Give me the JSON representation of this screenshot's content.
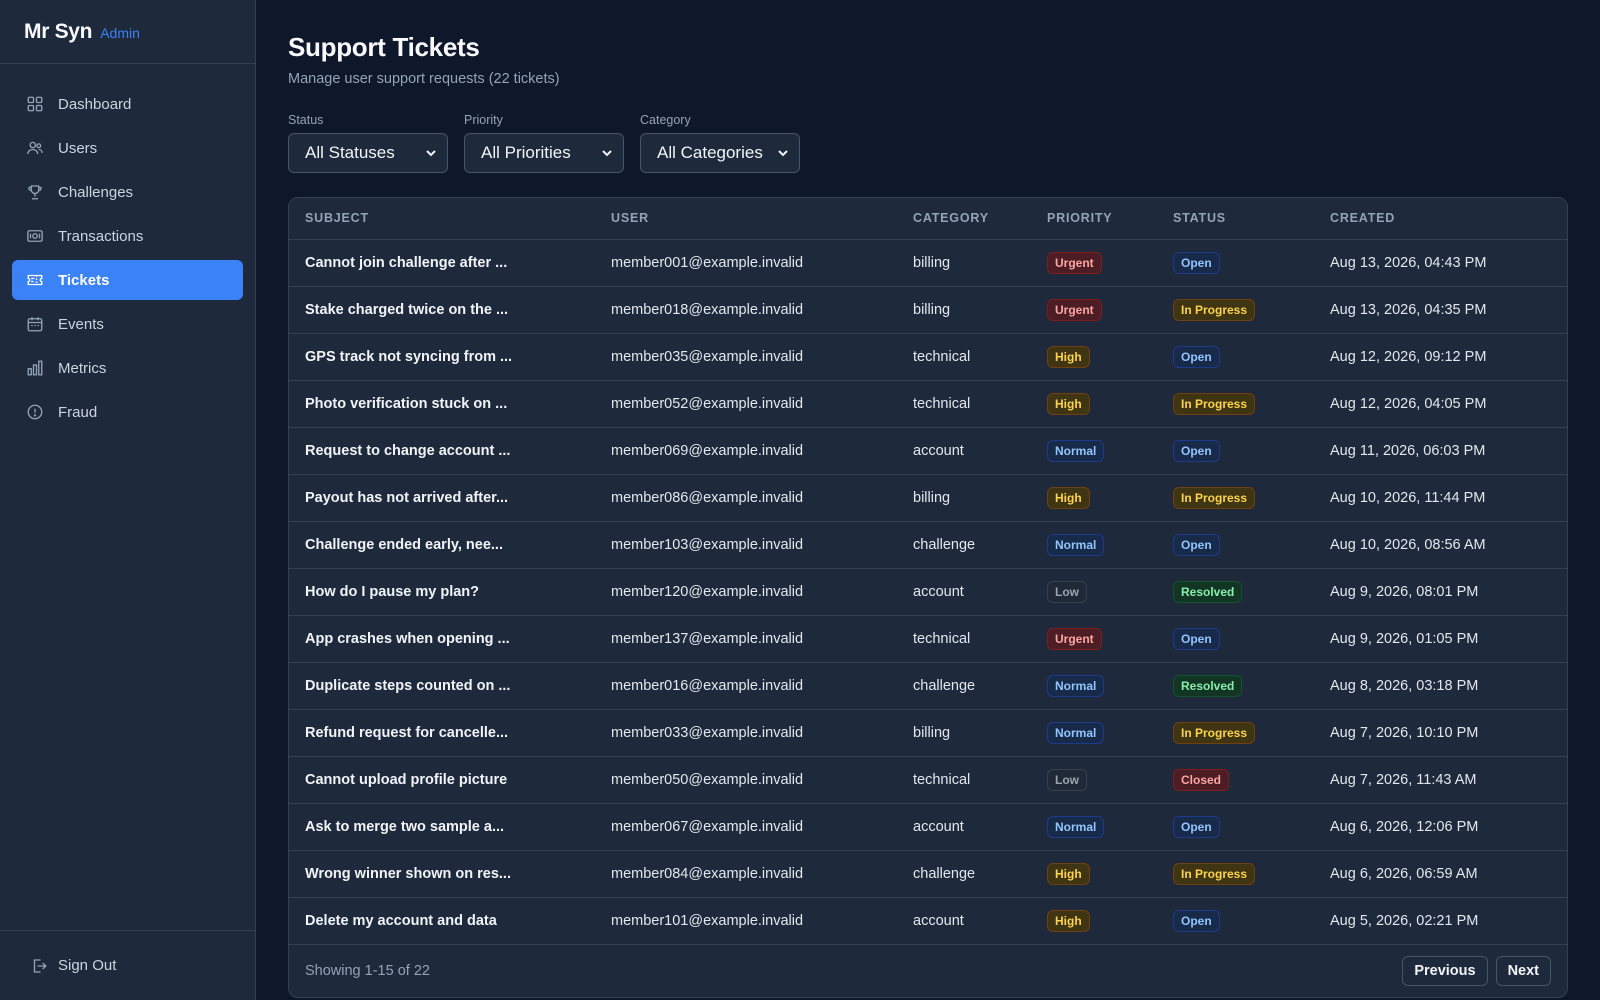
{
  "brand": {
    "name": "Mr Syn",
    "tag": "Admin"
  },
  "sidebar": {
    "items": [
      {
        "label": "Dashboard",
        "icon": "dashboard-icon"
      },
      {
        "label": "Users",
        "icon": "users-icon"
      },
      {
        "label": "Challenges",
        "icon": "trophy-icon"
      },
      {
        "label": "Transactions",
        "icon": "money-icon"
      },
      {
        "label": "Tickets",
        "icon": "ticket-icon",
        "active": true
      },
      {
        "label": "Events",
        "icon": "calendar-icon"
      },
      {
        "label": "Metrics",
        "icon": "bar-chart-icon"
      },
      {
        "label": "Fraud",
        "icon": "alert-circle-icon"
      }
    ],
    "signout_label": "Sign Out"
  },
  "header": {
    "title": "Support Tickets",
    "subtitle": "Manage user support requests (22 tickets)"
  },
  "filters": {
    "status": {
      "label": "Status",
      "value": "All Statuses"
    },
    "priority": {
      "label": "Priority",
      "value": "All Priorities"
    },
    "category": {
      "label": "Category",
      "value": "All Categories"
    }
  },
  "table": {
    "columns": [
      "SUBJECT",
      "USER",
      "CATEGORY",
      "PRIORITY",
      "STATUS",
      "CREATED"
    ],
    "rows": [
      {
        "subject": "Cannot join challenge after ...",
        "user": "member001@example.invalid",
        "category": "billing",
        "priority": "Urgent",
        "status": "Open",
        "created": "Aug 13, 2026, 04:43 PM"
      },
      {
        "subject": "Stake charged twice on the ...",
        "user": "member018@example.invalid",
        "category": "billing",
        "priority": "Urgent",
        "status": "In Progress",
        "created": "Aug 13, 2026, 04:35 PM"
      },
      {
        "subject": "GPS track not syncing from ...",
        "user": "member035@example.invalid",
        "category": "technical",
        "priority": "High",
        "status": "Open",
        "created": "Aug 12, 2026, 09:12 PM"
      },
      {
        "subject": "Photo verification stuck on ...",
        "user": "member052@example.invalid",
        "category": "technical",
        "priority": "High",
        "status": "In Progress",
        "created": "Aug 12, 2026, 04:05 PM"
      },
      {
        "subject": "Request to change account ...",
        "user": "member069@example.invalid",
        "category": "account",
        "priority": "Normal",
        "status": "Open",
        "created": "Aug 11, 2026, 06:03 PM"
      },
      {
        "subject": "Payout has not arrived after...",
        "user": "member086@example.invalid",
        "category": "billing",
        "priority": "High",
        "status": "In Progress",
        "created": "Aug 10, 2026, 11:44 PM"
      },
      {
        "subject": "Challenge ended early, nee...",
        "user": "member103@example.invalid",
        "category": "challenge",
        "priority": "Normal",
        "status": "Open",
        "created": "Aug 10, 2026, 08:56 AM"
      },
      {
        "subject": "How do I pause my plan?",
        "user": "member120@example.invalid",
        "category": "account",
        "priority": "Low",
        "status": "Resolved",
        "created": "Aug 9, 2026, 08:01 PM"
      },
      {
        "subject": "App crashes when opening ...",
        "user": "member137@example.invalid",
        "category": "technical",
        "priority": "Urgent",
        "status": "Open",
        "created": "Aug 9, 2026, 01:05 PM"
      },
      {
        "subject": "Duplicate steps counted on ...",
        "user": "member016@example.invalid",
        "category": "challenge",
        "priority": "Normal",
        "status": "Resolved",
        "created": "Aug 8, 2026, 03:18 PM"
      },
      {
        "subject": "Refund request for cancelle...",
        "user": "member033@example.invalid",
        "category": "billing",
        "priority": "Normal",
        "status": "In Progress",
        "created": "Aug 7, 2026, 10:10 PM"
      },
      {
        "subject": "Cannot upload profile picture",
        "user": "member050@example.invalid",
        "category": "technical",
        "priority": "Low",
        "status": "Closed",
        "created": "Aug 7, 2026, 11:43 AM"
      },
      {
        "subject": "Ask to merge two sample a...",
        "user": "member067@example.invalid",
        "category": "account",
        "priority": "Normal",
        "status": "Open",
        "created": "Aug 6, 2026, 12:06 PM"
      },
      {
        "subject": "Wrong winner shown on res...",
        "user": "member084@example.invalid",
        "category": "challenge",
        "priority": "High",
        "status": "In Progress",
        "created": "Aug 6, 2026, 06:59 AM"
      },
      {
        "subject": "Delete my account and data",
        "user": "member101@example.invalid",
        "category": "account",
        "priority": "High",
        "status": "Open",
        "created": "Aug 5, 2026, 02:21 PM"
      }
    ]
  },
  "pagination": {
    "summary": "Showing 1-15 of 22",
    "prev_label": "Previous",
    "next_label": "Next"
  },
  "colors": {
    "accent": "#3b82f6",
    "background": "#0f172a",
    "surface": "#1e293b"
  }
}
